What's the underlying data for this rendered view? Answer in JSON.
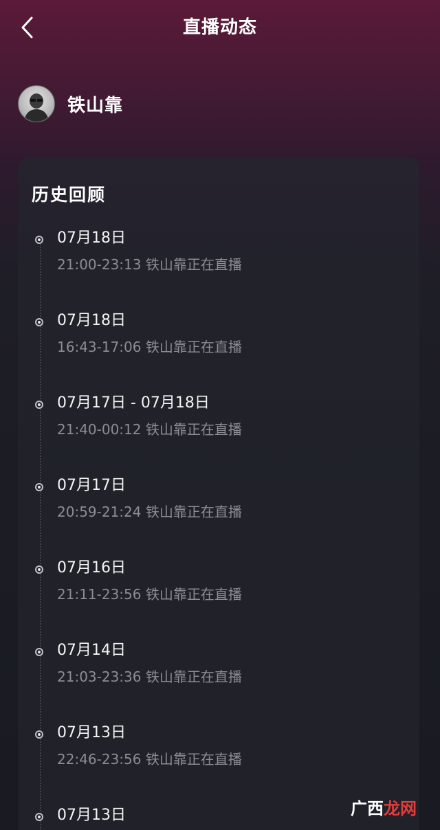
{
  "header": {
    "title": "直播动态"
  },
  "profile": {
    "name": "铁山靠"
  },
  "history": {
    "title": "历史回顾",
    "entries": [
      {
        "date": "07月18日",
        "time": "21:00-23:13 铁山靠正在直播"
      },
      {
        "date": "07月18日",
        "time": "16:43-17:06 铁山靠正在直播"
      },
      {
        "date": "07月17日 - 07月18日",
        "time": "21:40-00:12 铁山靠正在直播"
      },
      {
        "date": "07月17日",
        "time": "20:59-21:24 铁山靠正在直播"
      },
      {
        "date": "07月16日",
        "time": "21:11-23:56 铁山靠正在直播"
      },
      {
        "date": "07月14日",
        "time": "21:03-23:36 铁山靠正在直播"
      },
      {
        "date": "07月13日",
        "time": "22:46-23:56 铁山靠正在直播"
      },
      {
        "date": "07月13日",
        "time": ""
      }
    ]
  },
  "watermark": {
    "part1": "广西",
    "part2": "龙网"
  },
  "colors": {
    "accent": "#5a1a38",
    "background": "#1b1c24",
    "subtext": "#8d8d94"
  },
  "icons": {
    "back": "chevron-left-icon",
    "timeline": "radio-dot-icon"
  }
}
